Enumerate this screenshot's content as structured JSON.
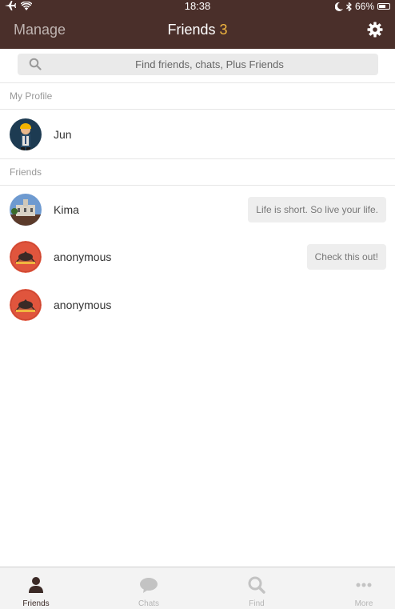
{
  "status_bar": {
    "time": "18:38",
    "battery": "66%"
  },
  "header": {
    "manage_label": "Manage",
    "title": "Friends",
    "count": "3"
  },
  "search": {
    "placeholder": "Find friends, chats, Plus Friends"
  },
  "my_profile": {
    "section_label": "My Profile",
    "name": "Jun"
  },
  "friends": {
    "section_label": "Friends",
    "items": [
      {
        "name": "Kima",
        "status": "Life is short. So live your life."
      },
      {
        "name": "anonymous",
        "status": "Check this out!"
      },
      {
        "name": "anonymous",
        "status": ""
      }
    ]
  },
  "tabbar": {
    "tabs": [
      {
        "label": "Friends",
        "icon": "person-icon",
        "active": true
      },
      {
        "label": "Chats",
        "icon": "speech-bubble-icon",
        "active": false
      },
      {
        "label": "Find",
        "icon": "search-icon",
        "active": false
      },
      {
        "label": "More",
        "icon": "more-dots-icon",
        "active": false
      }
    ]
  },
  "colors": {
    "header_bg": "#4a2f2a",
    "count_accent": "#f0b53f"
  }
}
